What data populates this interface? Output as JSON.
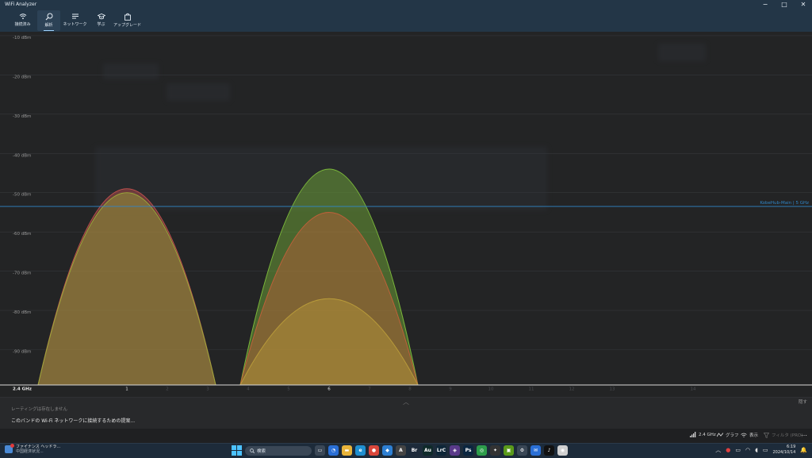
{
  "app_title": "WiFi Analyzer",
  "window_controls": [
    "−",
    "□",
    "✕"
  ],
  "nav": [
    {
      "label": "接続済み",
      "icon": "wifi-icon"
    },
    {
      "label": "解析",
      "icon": "search-icon",
      "active": true
    },
    {
      "label": "ネットワーク",
      "icon": "list-icon"
    },
    {
      "label": "学ぶ",
      "icon": "graduation-cap-icon"
    },
    {
      "label": "アップグレード",
      "icon": "shopping-bag-icon"
    }
  ],
  "chart_data": {
    "type": "area",
    "y_unit": "dBm",
    "y_ticks": [
      "-10 dBm",
      "-20 dBm",
      "-30 dBm",
      "-40 dBm",
      "-50 dBm",
      "-60 dBm",
      "-70 dBm",
      "-80 dBm",
      "-90 dBm"
    ],
    "ylim": [
      -99,
      -9
    ],
    "band_label": "2.4 GHz",
    "x_ticks": [
      {
        "label": "1",
        "ch": 1,
        "major": true
      },
      {
        "label": "2",
        "ch": 2
      },
      {
        "label": "3",
        "ch": 3
      },
      {
        "label": "4",
        "ch": 4
      },
      {
        "label": "5",
        "ch": 5
      },
      {
        "label": "6",
        "ch": 6,
        "major": true
      },
      {
        "label": "7",
        "ch": 7
      },
      {
        "label": "8",
        "ch": 8
      },
      {
        "label": "9",
        "ch": 9
      },
      {
        "label": "10",
        "ch": 10
      },
      {
        "label": "11",
        "ch": 11
      },
      {
        "label": "12",
        "ch": 12
      },
      {
        "label": "13",
        "ch": 13
      },
      {
        "label": "14",
        "ch": 15
      }
    ],
    "series": [
      {
        "channel": 1,
        "signal_dbm": -49,
        "color": "#c0504d"
      },
      {
        "channel": 1,
        "signal_dbm": -50,
        "color": "#9aa83a"
      },
      {
        "channel": 6,
        "signal_dbm": -44,
        "color": "#7bb83a"
      },
      {
        "channel": 6,
        "signal_dbm": -55,
        "color": "#c0603a"
      },
      {
        "channel": 6,
        "signal_dbm": -77,
        "color": "#b89a3a"
      }
    ],
    "reference_line": {
      "label": "KobeHub-Main | 5 GHz",
      "signal_dbm": -53.5,
      "color": "#2f86c8"
    },
    "grid": true
  },
  "info": {
    "no_rating": "レーティングは存在しません",
    "connect_msg": "このバンドの Wi-Fi ネットワークに接続するための提案...",
    "hide": "隠す"
  },
  "status": {
    "band": "2.4 GHz",
    "graph": "グラフ",
    "display": "表示",
    "filter": "フィルタ (PRO)",
    "more": "…"
  },
  "taskbar": {
    "weather_title": "ファイナンス ヘッドラ...",
    "weather_sub": "中国経済状況...",
    "search_placeholder": "検索",
    "apps": [
      {
        "name": "task-view-icon",
        "label": "▭",
        "color": "#3a4756"
      },
      {
        "name": "widgets-icon",
        "label": "◔",
        "color": "#2a6fd6"
      },
      {
        "name": "file-explorer-icon",
        "label": "▬",
        "color": "#e8b43a"
      },
      {
        "name": "edge-icon",
        "label": "e",
        "color": "#1f8fd0"
      },
      {
        "name": "chrome-icon",
        "label": "●",
        "color": "#d9473c"
      },
      {
        "name": "store-icon",
        "label": "◆",
        "color": "#2d7fd3"
      },
      {
        "name": "app-icon-a",
        "label": "A",
        "color": "#444"
      },
      {
        "name": "bridge-icon",
        "label": "Br",
        "color": "#1d2a3a"
      },
      {
        "name": "audition-icon",
        "label": "Au",
        "color": "#0f2a2a"
      },
      {
        "name": "lrc-icon",
        "label": "LrC",
        "color": "#0e2638"
      },
      {
        "name": "app-icon-b",
        "label": "◈",
        "color": "#5a3a8a"
      },
      {
        "name": "photoshop-icon",
        "label": "Ps",
        "color": "#0b2640"
      },
      {
        "name": "line-icon",
        "label": "◎",
        "color": "#2d9d4b"
      },
      {
        "name": "app-icon-c",
        "label": "✦",
        "color": "#333"
      },
      {
        "name": "nvidia-icon",
        "label": "▣",
        "color": "#5a9a1a"
      },
      {
        "name": "settings-icon",
        "label": "⚙",
        "color": "#3a4756"
      },
      {
        "name": "mail-icon",
        "label": "✉",
        "color": "#2a6fd6"
      },
      {
        "name": "tiktok-icon",
        "label": "♪",
        "color": "#111"
      },
      {
        "name": "wifi-analyzer-icon",
        "label": "◉",
        "color": "#d0d0d0"
      }
    ],
    "time": "6:19",
    "date": "2024/10/14"
  }
}
